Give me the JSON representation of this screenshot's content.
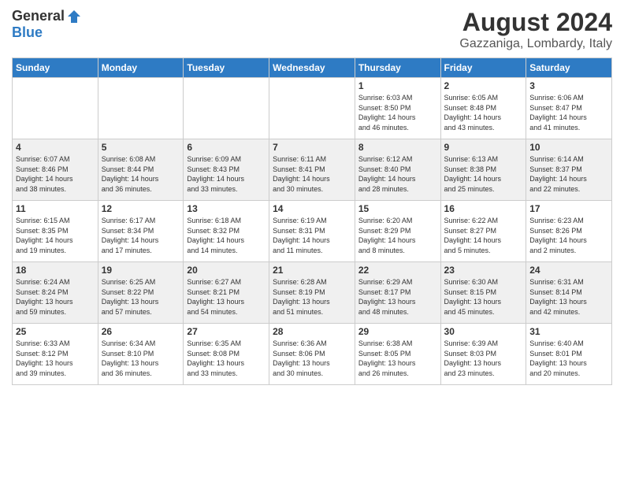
{
  "header": {
    "logo_general": "General",
    "logo_blue": "Blue",
    "month_year": "August 2024",
    "location": "Gazzaniga, Lombardy, Italy"
  },
  "weekdays": [
    "Sunday",
    "Monday",
    "Tuesday",
    "Wednesday",
    "Thursday",
    "Friday",
    "Saturday"
  ],
  "weeks": [
    [
      {
        "day": "",
        "info": ""
      },
      {
        "day": "",
        "info": ""
      },
      {
        "day": "",
        "info": ""
      },
      {
        "day": "",
        "info": ""
      },
      {
        "day": "1",
        "info": "Sunrise: 6:03 AM\nSunset: 8:50 PM\nDaylight: 14 hours\nand 46 minutes."
      },
      {
        "day": "2",
        "info": "Sunrise: 6:05 AM\nSunset: 8:48 PM\nDaylight: 14 hours\nand 43 minutes."
      },
      {
        "day": "3",
        "info": "Sunrise: 6:06 AM\nSunset: 8:47 PM\nDaylight: 14 hours\nand 41 minutes."
      }
    ],
    [
      {
        "day": "4",
        "info": "Sunrise: 6:07 AM\nSunset: 8:46 PM\nDaylight: 14 hours\nand 38 minutes."
      },
      {
        "day": "5",
        "info": "Sunrise: 6:08 AM\nSunset: 8:44 PM\nDaylight: 14 hours\nand 36 minutes."
      },
      {
        "day": "6",
        "info": "Sunrise: 6:09 AM\nSunset: 8:43 PM\nDaylight: 14 hours\nand 33 minutes."
      },
      {
        "day": "7",
        "info": "Sunrise: 6:11 AM\nSunset: 8:41 PM\nDaylight: 14 hours\nand 30 minutes."
      },
      {
        "day": "8",
        "info": "Sunrise: 6:12 AM\nSunset: 8:40 PM\nDaylight: 14 hours\nand 28 minutes."
      },
      {
        "day": "9",
        "info": "Sunrise: 6:13 AM\nSunset: 8:38 PM\nDaylight: 14 hours\nand 25 minutes."
      },
      {
        "day": "10",
        "info": "Sunrise: 6:14 AM\nSunset: 8:37 PM\nDaylight: 14 hours\nand 22 minutes."
      }
    ],
    [
      {
        "day": "11",
        "info": "Sunrise: 6:15 AM\nSunset: 8:35 PM\nDaylight: 14 hours\nand 19 minutes."
      },
      {
        "day": "12",
        "info": "Sunrise: 6:17 AM\nSunset: 8:34 PM\nDaylight: 14 hours\nand 17 minutes."
      },
      {
        "day": "13",
        "info": "Sunrise: 6:18 AM\nSunset: 8:32 PM\nDaylight: 14 hours\nand 14 minutes."
      },
      {
        "day": "14",
        "info": "Sunrise: 6:19 AM\nSunset: 8:31 PM\nDaylight: 14 hours\nand 11 minutes."
      },
      {
        "day": "15",
        "info": "Sunrise: 6:20 AM\nSunset: 8:29 PM\nDaylight: 14 hours\nand 8 minutes."
      },
      {
        "day": "16",
        "info": "Sunrise: 6:22 AM\nSunset: 8:27 PM\nDaylight: 14 hours\nand 5 minutes."
      },
      {
        "day": "17",
        "info": "Sunrise: 6:23 AM\nSunset: 8:26 PM\nDaylight: 14 hours\nand 2 minutes."
      }
    ],
    [
      {
        "day": "18",
        "info": "Sunrise: 6:24 AM\nSunset: 8:24 PM\nDaylight: 13 hours\nand 59 minutes."
      },
      {
        "day": "19",
        "info": "Sunrise: 6:25 AM\nSunset: 8:22 PM\nDaylight: 13 hours\nand 57 minutes."
      },
      {
        "day": "20",
        "info": "Sunrise: 6:27 AM\nSunset: 8:21 PM\nDaylight: 13 hours\nand 54 minutes."
      },
      {
        "day": "21",
        "info": "Sunrise: 6:28 AM\nSunset: 8:19 PM\nDaylight: 13 hours\nand 51 minutes."
      },
      {
        "day": "22",
        "info": "Sunrise: 6:29 AM\nSunset: 8:17 PM\nDaylight: 13 hours\nand 48 minutes."
      },
      {
        "day": "23",
        "info": "Sunrise: 6:30 AM\nSunset: 8:15 PM\nDaylight: 13 hours\nand 45 minutes."
      },
      {
        "day": "24",
        "info": "Sunrise: 6:31 AM\nSunset: 8:14 PM\nDaylight: 13 hours\nand 42 minutes."
      }
    ],
    [
      {
        "day": "25",
        "info": "Sunrise: 6:33 AM\nSunset: 8:12 PM\nDaylight: 13 hours\nand 39 minutes."
      },
      {
        "day": "26",
        "info": "Sunrise: 6:34 AM\nSunset: 8:10 PM\nDaylight: 13 hours\nand 36 minutes."
      },
      {
        "day": "27",
        "info": "Sunrise: 6:35 AM\nSunset: 8:08 PM\nDaylight: 13 hours\nand 33 minutes."
      },
      {
        "day": "28",
        "info": "Sunrise: 6:36 AM\nSunset: 8:06 PM\nDaylight: 13 hours\nand 30 minutes."
      },
      {
        "day": "29",
        "info": "Sunrise: 6:38 AM\nSunset: 8:05 PM\nDaylight: 13 hours\nand 26 minutes."
      },
      {
        "day": "30",
        "info": "Sunrise: 6:39 AM\nSunset: 8:03 PM\nDaylight: 13 hours\nand 23 minutes."
      },
      {
        "day": "31",
        "info": "Sunrise: 6:40 AM\nSunset: 8:01 PM\nDaylight: 13 hours\nand 20 minutes."
      }
    ]
  ]
}
